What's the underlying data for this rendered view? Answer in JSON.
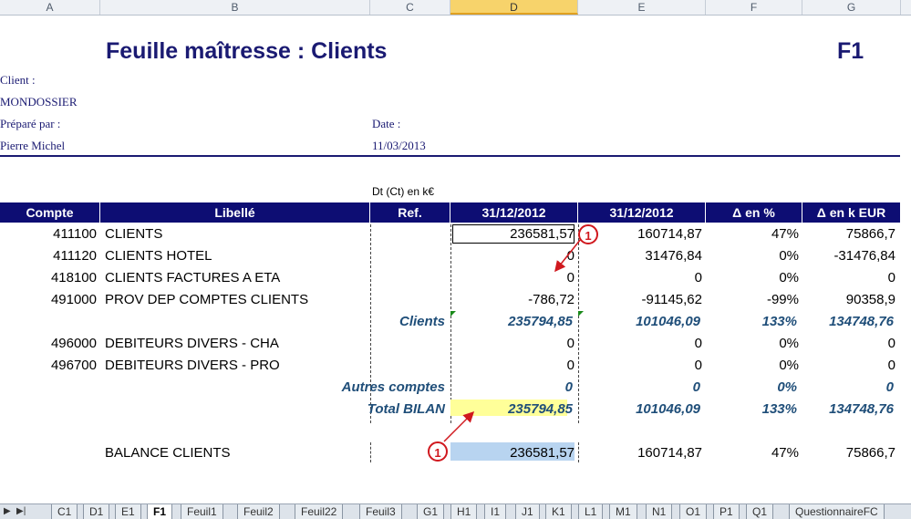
{
  "columns": [
    "A",
    "B",
    "C",
    "D",
    "E",
    "F",
    "G"
  ],
  "title": "Feuille maîtresse : Clients",
  "sheet_code": "F1",
  "client_label": "Client :",
  "client_value": "MONDOSSIER",
  "prepared_label": "Préparé par :",
  "prepared_value": "Pierre Michel",
  "date_label": "Date :",
  "date_value": "11/03/2013",
  "unit_note": "Dt (Ct) en k€",
  "headers": [
    "Compte",
    "Libellé",
    "Ref.",
    "31/12/2012",
    "31/12/2012",
    "Δ en %",
    "Δ en k EUR"
  ],
  "rows": [
    {
      "compte": "411100",
      "libelle": "CLIENTS",
      "d": "236581,57",
      "e": "160714,87",
      "f": "47%",
      "g": "75866,7"
    },
    {
      "compte": "411120",
      "libelle": "CLIENTS HOTEL",
      "d": "0",
      "e": "31476,84",
      "f": "0%",
      "g": "-31476,84"
    },
    {
      "compte": "418100",
      "libelle": "CLIENTS FACTURES A ETA",
      "d": "0",
      "e": "0",
      "f": "0%",
      "g": "0"
    },
    {
      "compte": "491000",
      "libelle": "PROV DEP COMPTES CLIENTS",
      "d": "-786,72",
      "e": "-91145,62",
      "f": "-99%",
      "g": "90358,9"
    }
  ],
  "subtotal_clients": {
    "label": "Clients",
    "d": "235794,85",
    "e": "101046,09",
    "f": "133%",
    "g": "134748,76"
  },
  "rows2": [
    {
      "compte": "496000",
      "libelle": "DEBITEURS DIVERS - CHA",
      "d": "0",
      "e": "0",
      "f": "0%",
      "g": "0"
    },
    {
      "compte": "496700",
      "libelle": "DEBITEURS DIVERS - PRO",
      "d": "0",
      "e": "0",
      "f": "0%",
      "g": "0"
    }
  ],
  "subtotal_autres": {
    "label": "Autres comptes",
    "d": "0",
    "e": "0",
    "f": "0%",
    "g": "0"
  },
  "total_bilan": {
    "label": "Total BILAN",
    "d": "235794,85",
    "e": "101046,09",
    "f": "133%",
    "g": "134748,76"
  },
  "balance": {
    "label": "BALANCE CLIENTS",
    "d": "236581,57",
    "e": "160714,87",
    "f": "47%",
    "g": "75866,7"
  },
  "marker_label": "1",
  "tabs": [
    "C1",
    "D1",
    "E1",
    "F1",
    "Feuil1",
    "Feuil2",
    "Feuil22",
    "Feuil3",
    "G1",
    "H1",
    "I1",
    "J1",
    "K1",
    "L1",
    "M1",
    "N1",
    "O1",
    "P1",
    "Q1",
    "QuestionnaireFC"
  ],
  "active_tab": "F1"
}
